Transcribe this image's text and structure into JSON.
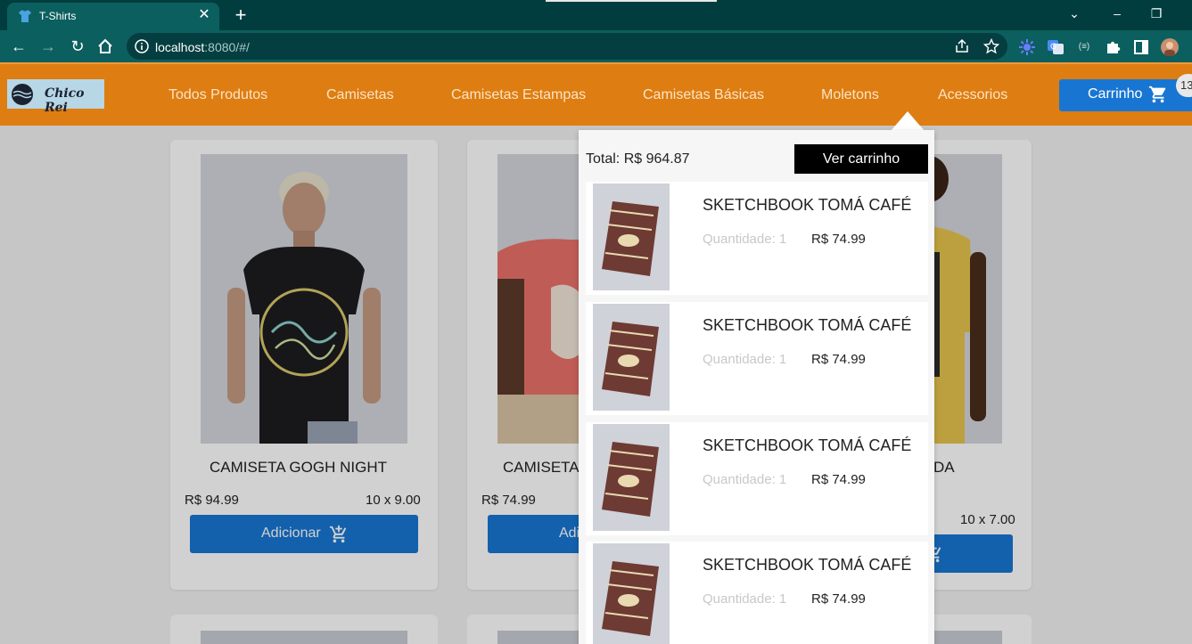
{
  "browser": {
    "tab_title": "T-Shirts",
    "url_host": "localhost",
    "url_rest": ":8080/#/"
  },
  "navbar": {
    "logo_text": "Chico Rei",
    "links": [
      "Todos Produtos",
      "Camisetas",
      "Camisetas Estampas",
      "Camisetas Básicas",
      "Moletons",
      "Acessorios"
    ],
    "cart_label": "Carrinho",
    "cart_count": "13"
  },
  "products": [
    {
      "title": "CAMISETA GOGH NIGHT",
      "price": "R$ 94.99",
      "installments": "10 x 9.00",
      "add_label": "Adicionar"
    },
    {
      "title": "CAMISETA",
      "price": "R$ 74.99",
      "installments": "",
      "add_label": "Adi"
    },
    {
      "title": "DA",
      "price": "",
      "installments": "10 x 7.00",
      "add_label": ""
    }
  ],
  "cart_dropdown": {
    "total": "Total: R$ 964.87",
    "view_cart_label": "Ver carrinho",
    "items": [
      {
        "name": "SKETCHBOOK TOMÁ CAFÉ",
        "quantity": "Quantidade: 1",
        "price": "R$ 74.99"
      },
      {
        "name": "SKETCHBOOK TOMÁ CAFÉ",
        "quantity": "Quantidade: 1",
        "price": "R$ 74.99"
      },
      {
        "name": "SKETCHBOOK TOMÁ CAFÉ",
        "quantity": "Quantidade: 1",
        "price": "R$ 74.99"
      },
      {
        "name": "SKETCHBOOK TOMÁ CAFÉ",
        "quantity": "Quantidade: 1",
        "price": "R$ 74.99"
      }
    ]
  },
  "colors": {
    "nav_orange": "#de7d12",
    "primary_blue": "#1876d2",
    "browser_teal": "#0c5f5f"
  }
}
